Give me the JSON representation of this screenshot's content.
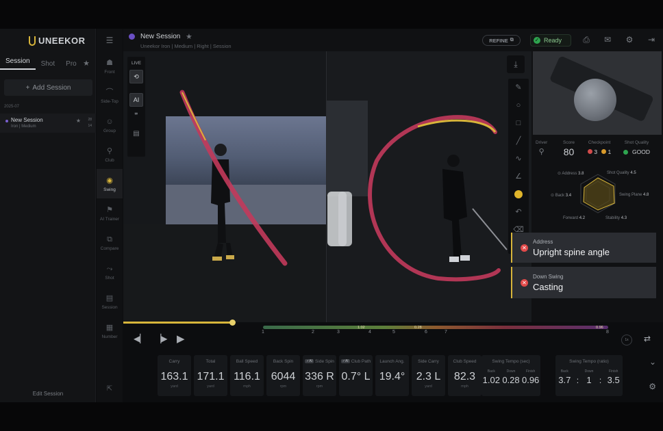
{
  "brand": {
    "logo_text": "UNEEKOR"
  },
  "sidebar": {
    "tabs": [
      "Session",
      "Shot",
      "Pro"
    ],
    "add_session": "Add Session",
    "date_group": "2025-07",
    "session": {
      "name": "New Session",
      "sub": "Iron | Medium",
      "count_top": "28",
      "count_bot": "14"
    },
    "edit_session": "Edit Session"
  },
  "rail": [
    {
      "label": "Front",
      "icon": "golfer-front-icon",
      "glyph": "☗"
    },
    {
      "label": "Side-Top",
      "icon": "swing-arc-icon",
      "glyph": "⌒"
    },
    {
      "label": "Group",
      "icon": "group-icon",
      "glyph": "☺"
    },
    {
      "label": "Club",
      "icon": "club-icon",
      "glyph": "⚲"
    },
    {
      "label": "Swing",
      "icon": "camera-icon",
      "glyph": "◉"
    },
    {
      "label": "AI Trainer",
      "icon": "ai-trainer-icon",
      "glyph": "⚑"
    },
    {
      "label": "Compare",
      "icon": "compare-icon",
      "glyph": "⧉"
    },
    {
      "label": "Shot",
      "icon": "shot-icon",
      "glyph": "⤳"
    },
    {
      "label": "Session",
      "icon": "session-icon",
      "glyph": "▤"
    },
    {
      "label": "Number",
      "icon": "number-icon",
      "glyph": "▦"
    }
  ],
  "header": {
    "title": "New Session",
    "subtitle": "Uneekor  Iron | Medium | Right | Session",
    "refine": "REFINE",
    "status": "Ready"
  },
  "video": {
    "live_label": "LIVE",
    "ai_label": "AI"
  },
  "right_panel": {
    "driver_label": "Driver",
    "score_label": "Score",
    "score": "80",
    "checkpoint_label": "Checkpoint",
    "checkpoint_red": "3",
    "checkpoint_yellow": "1",
    "shot_quality_label": "Shot Quality",
    "shot_quality": "GOOD",
    "radar": [
      {
        "name": "Address",
        "value": "3.8"
      },
      {
        "name": "Shot Quality",
        "value": "4.5"
      },
      {
        "name": "Back",
        "value": "3.4"
      },
      {
        "name": "Swing Plane",
        "value": "4.8"
      },
      {
        "name": "Forward",
        "value": "4.2"
      },
      {
        "name": "Stability",
        "value": "4.3"
      }
    ]
  },
  "alerts": [
    {
      "phase": "Address",
      "issue": "Upright spine angle"
    },
    {
      "phase": "Down Swing",
      "issue": "Casting"
    }
  ],
  "timeline": {
    "tags": [
      "1.02",
      "0.28",
      "0.96"
    ],
    "phases": [
      "1",
      "2",
      "3",
      "4",
      "5",
      "6",
      "7",
      "8"
    ],
    "speed_label": "1x"
  },
  "metrics": [
    {
      "title": "Carry",
      "value": "163.1",
      "unit": "yard",
      "ai": false
    },
    {
      "title": "Total",
      "value": "171.1",
      "unit": "yard",
      "ai": false
    },
    {
      "title": "Ball Speed",
      "value": "116.1",
      "unit": "mph",
      "ai": false
    },
    {
      "title": "Back Spin",
      "value": "6044",
      "unit": "rpm",
      "ai": false
    },
    {
      "title": "Side Spin",
      "value": "336 R",
      "unit": "rpm",
      "ai": true
    },
    {
      "title": "Club Path",
      "value": "0.7° L",
      "unit": "",
      "ai": true
    },
    {
      "title": "Launch Ang.",
      "value": "19.4°",
      "unit": "",
      "ai": false
    },
    {
      "title": "Side Carry",
      "value": "2.3 L",
      "unit": "yard",
      "ai": false
    },
    {
      "title": "Club Speed",
      "value": "82.3",
      "unit": "mph",
      "ai": false
    }
  ],
  "tempo_sec": {
    "title": "Swing Tempo (sec)",
    "cols": [
      [
        "Back",
        "1.02"
      ],
      [
        "Down",
        "0.28"
      ],
      [
        "Finish",
        "0.96"
      ]
    ]
  },
  "tempo_ratio": {
    "title": "Swing Tempo (ratio)",
    "cols": [
      [
        "Back",
        "3.7"
      ],
      [
        "Down",
        "1"
      ],
      [
        "Finish",
        "3.5"
      ]
    ]
  }
}
